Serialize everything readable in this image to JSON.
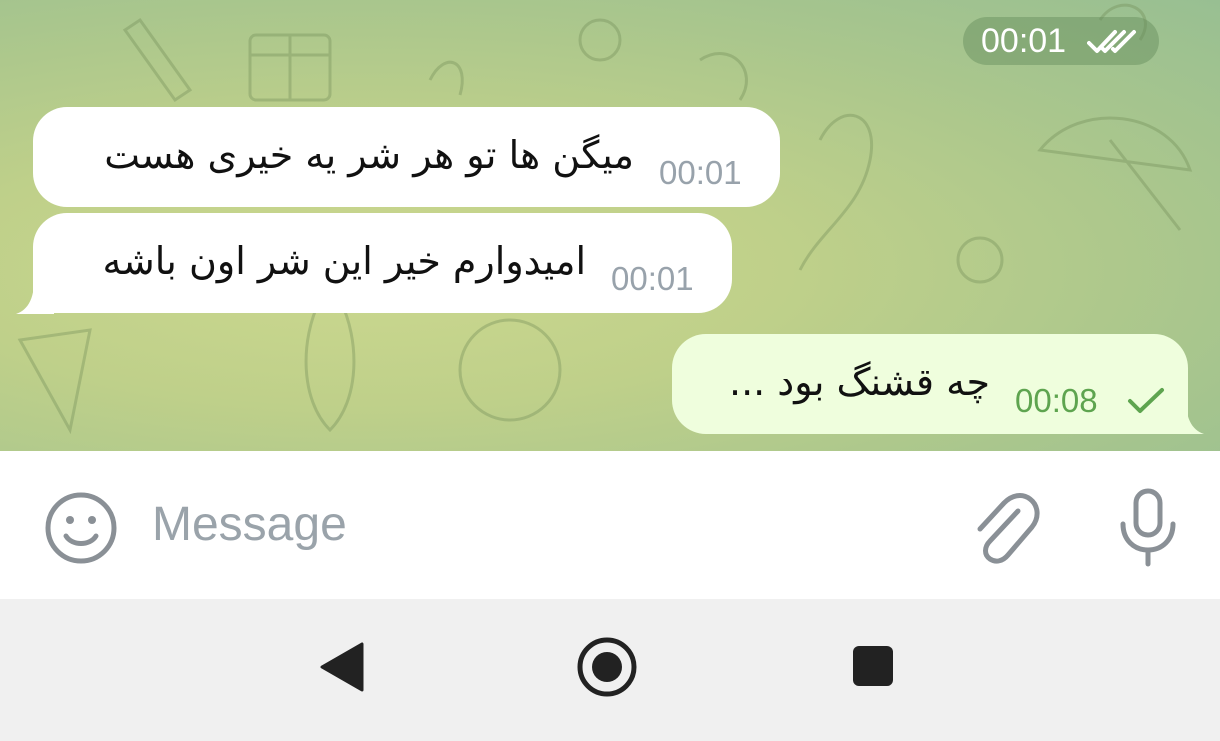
{
  "chat": {
    "top_status": {
      "time": "00:01",
      "icon": "double-check-icon"
    },
    "messages": [
      {
        "direction": "incoming",
        "text": "میگن ها تو هر شر یه خیری هست",
        "time": "00:01"
      },
      {
        "direction": "incoming",
        "text": "امیدوارم خیر این شر اون باشه",
        "time": "00:01"
      },
      {
        "direction": "outgoing",
        "text": "چه قشنگ بود ...",
        "time": "00:08",
        "status_icon": "check-icon"
      }
    ],
    "colors": {
      "incoming_bubble": "#ffffff",
      "outgoing_bubble": "#effedd",
      "outgoing_time": "#5ea44f"
    }
  },
  "input": {
    "placeholder": "Message",
    "icons": [
      "emoji-icon",
      "attach-icon",
      "microphone-icon"
    ]
  },
  "navigation": {
    "icons": [
      "back-icon",
      "home-icon",
      "recents-icon"
    ]
  }
}
